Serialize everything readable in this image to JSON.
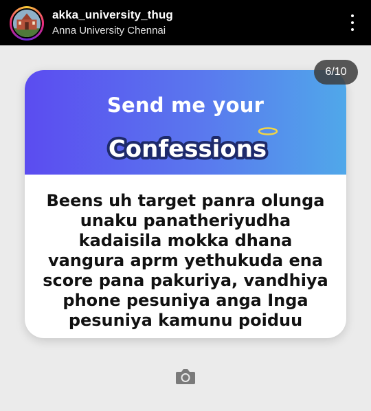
{
  "header": {
    "account_name": "akka_university_thug",
    "location": "Anna University Chennai",
    "avatar_icon": "university-building-avatar",
    "more_icon": "more-vertical-icon"
  },
  "story": {
    "page_counter": "6/10"
  },
  "card": {
    "banner_title": "Send me your",
    "banner_subtitle": "Confessions",
    "confession_text": "Beens uh target panra olunga unaku panatheriyudha kadaisila mokka dhana vangura aprm yethukuda ena score pana pakuriya, vandhiya phone pesuniya anga Inga pesuniya kamunu poiduu",
    "halo_icon": "halo-icon",
    "colors": {
      "banner_start": "#5b4cf0",
      "banner_end": "#50a8ea",
      "subtitle_fill": "#ffffff",
      "subtitle_stroke": "#1e2a6b",
      "halo": "#f2d544"
    }
  },
  "footer": {
    "camera_icon": "camera-icon"
  }
}
